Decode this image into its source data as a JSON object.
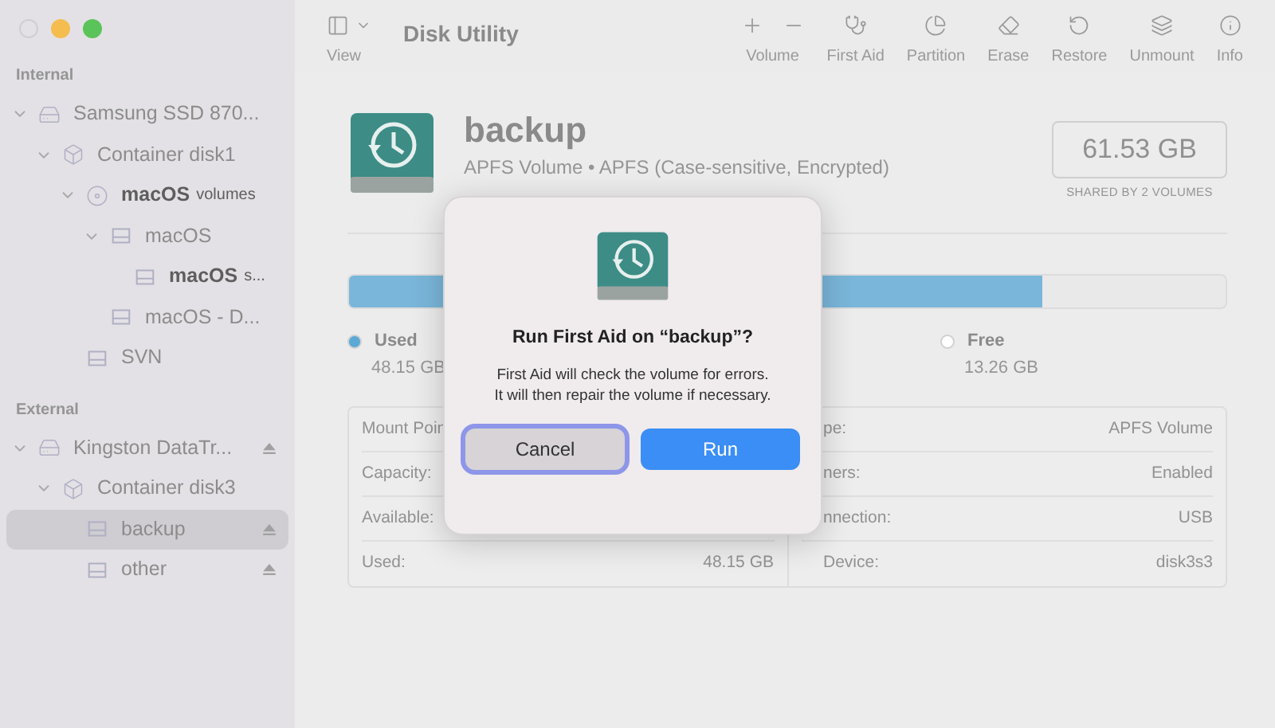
{
  "window": {
    "title": "Disk Utility"
  },
  "toolbar": {
    "view": {
      "label": "View"
    },
    "buttons": [
      {
        "kind": "volume",
        "label": "Volume"
      },
      {
        "kind": "first_aid",
        "label": "First Aid"
      },
      {
        "kind": "partition",
        "label": "Partition"
      },
      {
        "kind": "erase",
        "label": "Erase"
      },
      {
        "kind": "restore",
        "label": "Restore"
      },
      {
        "kind": "unmount",
        "label": "Unmount"
      },
      {
        "kind": "info",
        "label": "Info"
      }
    ]
  },
  "sidebar": {
    "sections": [
      {
        "title": "Internal",
        "items": [
          {
            "kind": "disk",
            "name": "Samsung SSD 870...",
            "emphasized": false,
            "selected": false,
            "ejectable": false,
            "expanded": true,
            "children": [
              {
                "kind": "container",
                "name": "Container disk1",
                "emphasized": false,
                "selected": false,
                "ejectable": false,
                "expanded": true,
                "children": [
                  {
                    "kind": "stack",
                    "name": "macOS",
                    "detail": "volumes",
                    "emphasized": true,
                    "selected": false,
                    "ejectable": false,
                    "expanded": true,
                    "children": [
                      {
                        "kind": "volume",
                        "name": "macOS",
                        "emphasized": false,
                        "selected": false,
                        "ejectable": false,
                        "expanded": true,
                        "children": [
                          {
                            "kind": "volume",
                            "name": "macOS",
                            "detail": "s...",
                            "emphasized": true,
                            "selected": false,
                            "ejectable": false
                          }
                        ]
                      },
                      {
                        "kind": "volume",
                        "name": "macOS - D...",
                        "emphasized": false,
                        "selected": false,
                        "ejectable": false
                      }
                    ]
                  },
                  {
                    "kind": "volume",
                    "name": "SVN",
                    "emphasized": false,
                    "selected": false,
                    "ejectable": false
                  }
                ]
              }
            ]
          }
        ]
      },
      {
        "title": "External",
        "items": [
          {
            "kind": "disk",
            "name": "Kingston DataTr...",
            "emphasized": false,
            "selected": false,
            "ejectable": true,
            "expanded": true,
            "children": [
              {
                "kind": "container",
                "name": "Container disk3",
                "emphasized": false,
                "selected": false,
                "ejectable": false,
                "expanded": true,
                "children": [
                  {
                    "kind": "volume",
                    "name": "backup",
                    "emphasized": false,
                    "selected": true,
                    "ejectable": true
                  },
                  {
                    "kind": "volume",
                    "name": "other",
                    "emphasized": false,
                    "selected": false,
                    "ejectable": true
                  }
                ]
              }
            ]
          }
        ]
      }
    ]
  },
  "volume": {
    "name": "backup",
    "description": "APFS Volume • APFS (Case-sensitive, Encrypted)",
    "capacity": "61.53 GB",
    "capacity_note": "SHARED BY 2 VOLUMES",
    "usage": {
      "level": 0.79,
      "legend": [
        {
          "label": "Used",
          "value": "48.15 GB",
          "color": "#5aa9d6"
        },
        {
          "label": "Free",
          "value": "13.26 GB",
          "color": "#ffffff"
        }
      ]
    }
  },
  "details": {
    "left": [
      {
        "label": "Mount Poin"
      },
      {
        "label": "Capacity:"
      },
      {
        "label": "Available:"
      },
      {
        "label": "Used:",
        "value": "48.15 GB"
      }
    ],
    "right": [
      {
        "label": "pe:",
        "value": "APFS Volume"
      },
      {
        "label": "ners:",
        "value": "Enabled"
      },
      {
        "label": "nnection:",
        "value": "USB"
      },
      {
        "label": "Device:",
        "value": "disk3s3"
      }
    ]
  },
  "dialog": {
    "title": "Run First Aid on “backup”?",
    "message": "First Aid will check the volume for errors. It will then repair the volume if necessary.",
    "buttons": [
      {
        "kind": "secondary",
        "label": "Cancel",
        "focused": true
      },
      {
        "kind": "primary",
        "label": "Run",
        "focused": false
      }
    ]
  }
}
